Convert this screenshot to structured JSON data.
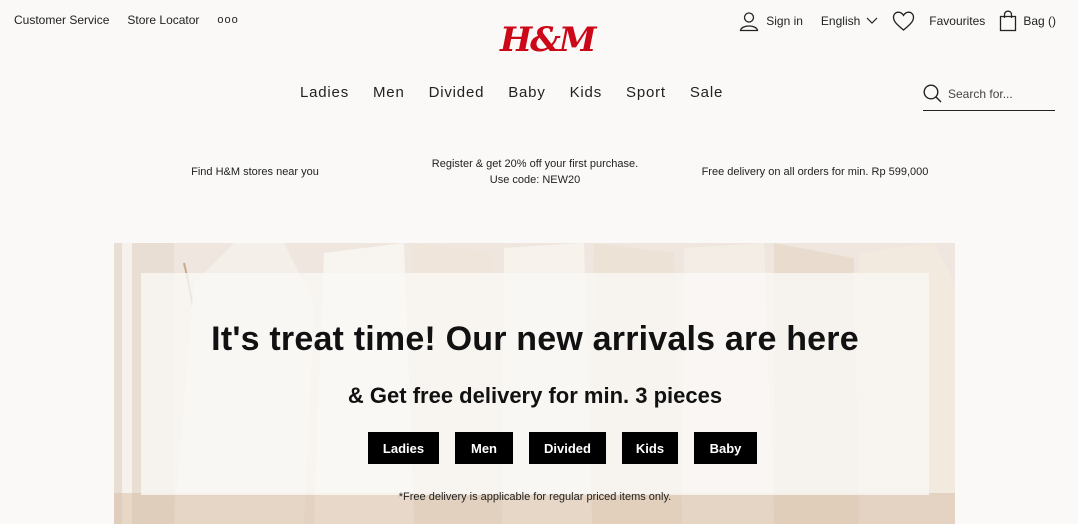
{
  "topbar": {
    "customer_service": "Customer Service",
    "store_locator": "Store Locator",
    "more": "ooo"
  },
  "logo": {
    "text": "H&M",
    "color": "#cc0717"
  },
  "account": {
    "sign_in": "Sign in",
    "language": "English",
    "favourites": "Favourites",
    "bag": "Bag ()"
  },
  "nav": {
    "items": [
      {
        "label": "Ladies"
      },
      {
        "label": "Men"
      },
      {
        "label": "Divided"
      },
      {
        "label": "Baby"
      },
      {
        "label": "Kids"
      },
      {
        "label": "Sport"
      },
      {
        "label": "Sale"
      }
    ]
  },
  "search": {
    "placeholder": "Search for..."
  },
  "promo": {
    "stores": "Find H&M stores near you",
    "register_line1": "Register & get 20% off your first purchase.",
    "register_line2": "Use code: NEW20",
    "delivery": "Free delivery on all orders for min. Rp 599,000"
  },
  "hero": {
    "title": "It's treat time! Our new arrivals are here",
    "subtitle": "& Get free delivery for min. 3 pieces",
    "buttons": [
      {
        "label": "Ladies"
      },
      {
        "label": "Men"
      },
      {
        "label": "Divided"
      },
      {
        "label": "Kids"
      },
      {
        "label": "Baby"
      }
    ],
    "note": "*Free delivery is applicable for regular priced items only."
  }
}
